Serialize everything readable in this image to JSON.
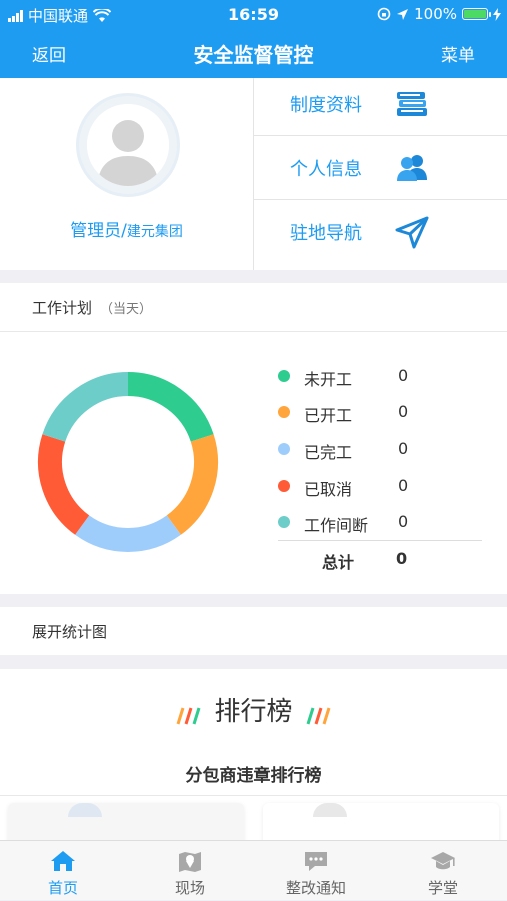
{
  "status_bar": {
    "carrier": "中国联通",
    "time": "16:59",
    "battery": "100%"
  },
  "nav": {
    "back": "返回",
    "title": "安全监督管控",
    "menu": "菜单"
  },
  "profile": {
    "name": "管理员",
    "company": "建元集团"
  },
  "quick_menu": [
    {
      "label": "制度资料",
      "icon": "books-icon"
    },
    {
      "label": "个人信息",
      "icon": "users-icon"
    },
    {
      "label": "驻地导航",
      "icon": "navigation-arrow-icon"
    }
  ],
  "work_plan": {
    "title": "工作计划",
    "subtitle": "（当天）",
    "legend": [
      {
        "label": "未开工",
        "value": "0",
        "color": "#2ecc8f"
      },
      {
        "label": "已开工",
        "value": "0",
        "color": "#ffa53b"
      },
      {
        "label": "已完工",
        "value": "0",
        "color": "#9fcdfb"
      },
      {
        "label": "已取消",
        "value": "0",
        "color": "#ff5b36"
      },
      {
        "label": "工作间断",
        "value": "0",
        "color": "#6dcdc9"
      }
    ],
    "total_label": "总计",
    "total_value": "0"
  },
  "expand_label": "展开统计图",
  "ranking": {
    "title": "排行榜",
    "subtitle": "分包商违章排行榜"
  },
  "tabs": [
    {
      "label": "首页",
      "icon": "home-icon",
      "active": true
    },
    {
      "label": "现场",
      "icon": "map-pin-icon",
      "active": false
    },
    {
      "label": "整改通知",
      "icon": "message-icon",
      "active": false
    },
    {
      "label": "学堂",
      "icon": "graduation-cap-icon",
      "active": false
    }
  ]
}
